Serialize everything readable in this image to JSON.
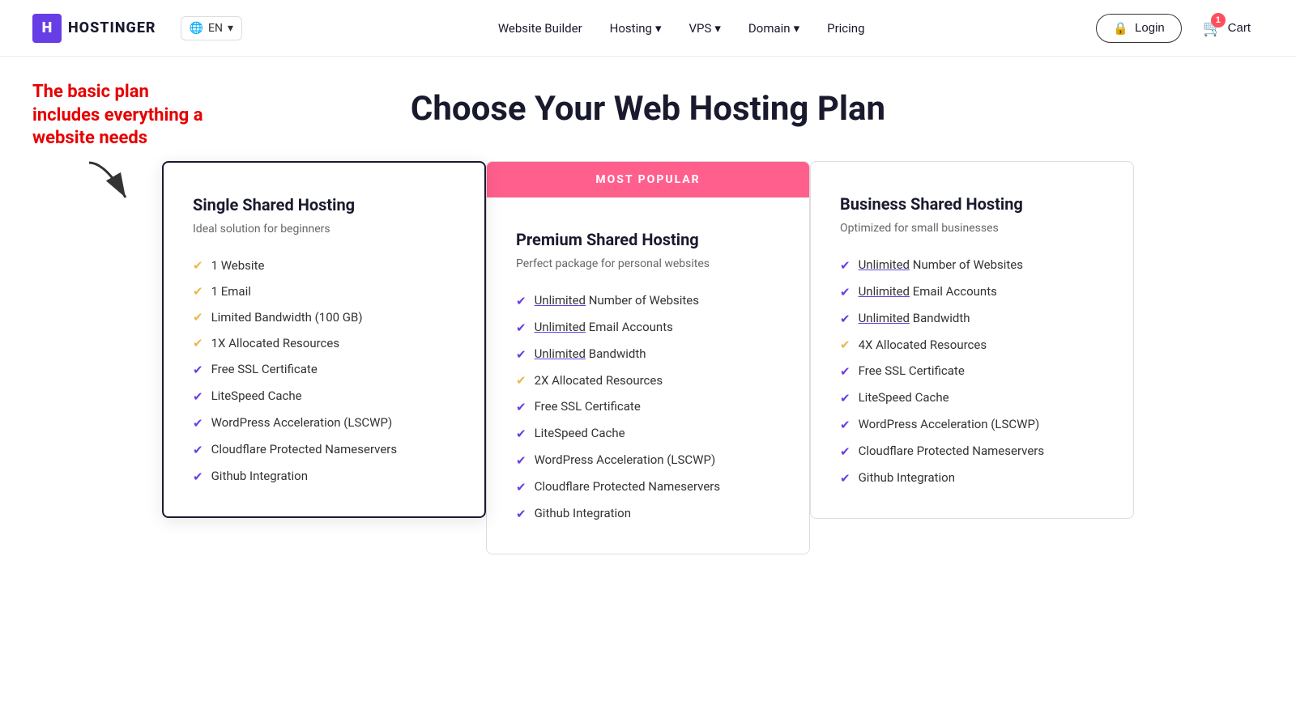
{
  "brand": {
    "logo_icon": "H",
    "logo_text": "HOSTINGER"
  },
  "lang": {
    "label": "EN",
    "icon": "🌐"
  },
  "nav": {
    "links": [
      {
        "label": "Website Builder",
        "has_dropdown": false
      },
      {
        "label": "Hosting",
        "has_dropdown": true
      },
      {
        "label": "VPS",
        "has_dropdown": true
      },
      {
        "label": "Domain",
        "has_dropdown": true
      },
      {
        "label": "Pricing",
        "has_dropdown": false
      }
    ],
    "login_label": "Login",
    "cart_label": "Cart",
    "cart_count": "1"
  },
  "annotation": {
    "text": "The basic plan includes everything a website needs"
  },
  "page": {
    "title": "Choose Your Web Hosting Plan"
  },
  "popular_badge": "MOST POPULAR",
  "plans": [
    {
      "id": "single",
      "name": "Single Shared Hosting",
      "subtitle": "Ideal solution for beginners",
      "highlighted": true,
      "features": [
        {
          "text": "1 Website",
          "underline": false
        },
        {
          "text": "1 Email",
          "underline": false
        },
        {
          "text": "Limited Bandwidth (100 GB)",
          "underline": false
        },
        {
          "text": "1X Allocated Resources",
          "underline": false
        },
        {
          "text": "Free SSL Certificate",
          "underline": false
        },
        {
          "text": "LiteSpeed Cache",
          "underline": false
        },
        {
          "text": "WordPress Acceleration (LSCWP)",
          "underline": false
        },
        {
          "text": "Cloudflare Protected Nameservers",
          "underline": false
        },
        {
          "text": "Github Integration",
          "underline": false
        }
      ]
    },
    {
      "id": "premium",
      "name": "Premium Shared Hosting",
      "subtitle": "Perfect package for personal websites",
      "popular": true,
      "features": [
        {
          "text": "Number of Websites",
          "prefix": "Unlimited",
          "underline": true
        },
        {
          "text": "Email Accounts",
          "prefix": "Unlimited",
          "underline": true
        },
        {
          "text": "Bandwidth",
          "prefix": "Unlimited",
          "underline": true
        },
        {
          "text": "2X Allocated Resources",
          "underline": false
        },
        {
          "text": "Free SSL Certificate",
          "underline": false
        },
        {
          "text": "LiteSpeed Cache",
          "underline": false
        },
        {
          "text": "WordPress Acceleration (LSCWP)",
          "underline": false
        },
        {
          "text": "Cloudflare Protected Nameservers",
          "underline": false
        },
        {
          "text": "Github Integration",
          "underline": false
        }
      ]
    },
    {
      "id": "business",
      "name": "Business Shared Hosting",
      "subtitle": "Optimized for small businesses",
      "features": [
        {
          "text": "Number of Websites",
          "prefix": "Unlimited",
          "underline": true
        },
        {
          "text": "Email Accounts",
          "prefix": "Unlimited",
          "underline": true
        },
        {
          "text": "Bandwidth",
          "prefix": "Unlimited",
          "underline": true
        },
        {
          "text": "4X Allocated Resources",
          "underline": false
        },
        {
          "text": "Free SSL Certificate",
          "underline": false
        },
        {
          "text": "LiteSpeed Cache",
          "underline": false
        },
        {
          "text": "WordPress Acceleration (LSCWP)",
          "underline": false
        },
        {
          "text": "Cloudflare Protected Nameservers",
          "underline": false
        },
        {
          "text": "Github Integration",
          "underline": false
        }
      ]
    }
  ]
}
